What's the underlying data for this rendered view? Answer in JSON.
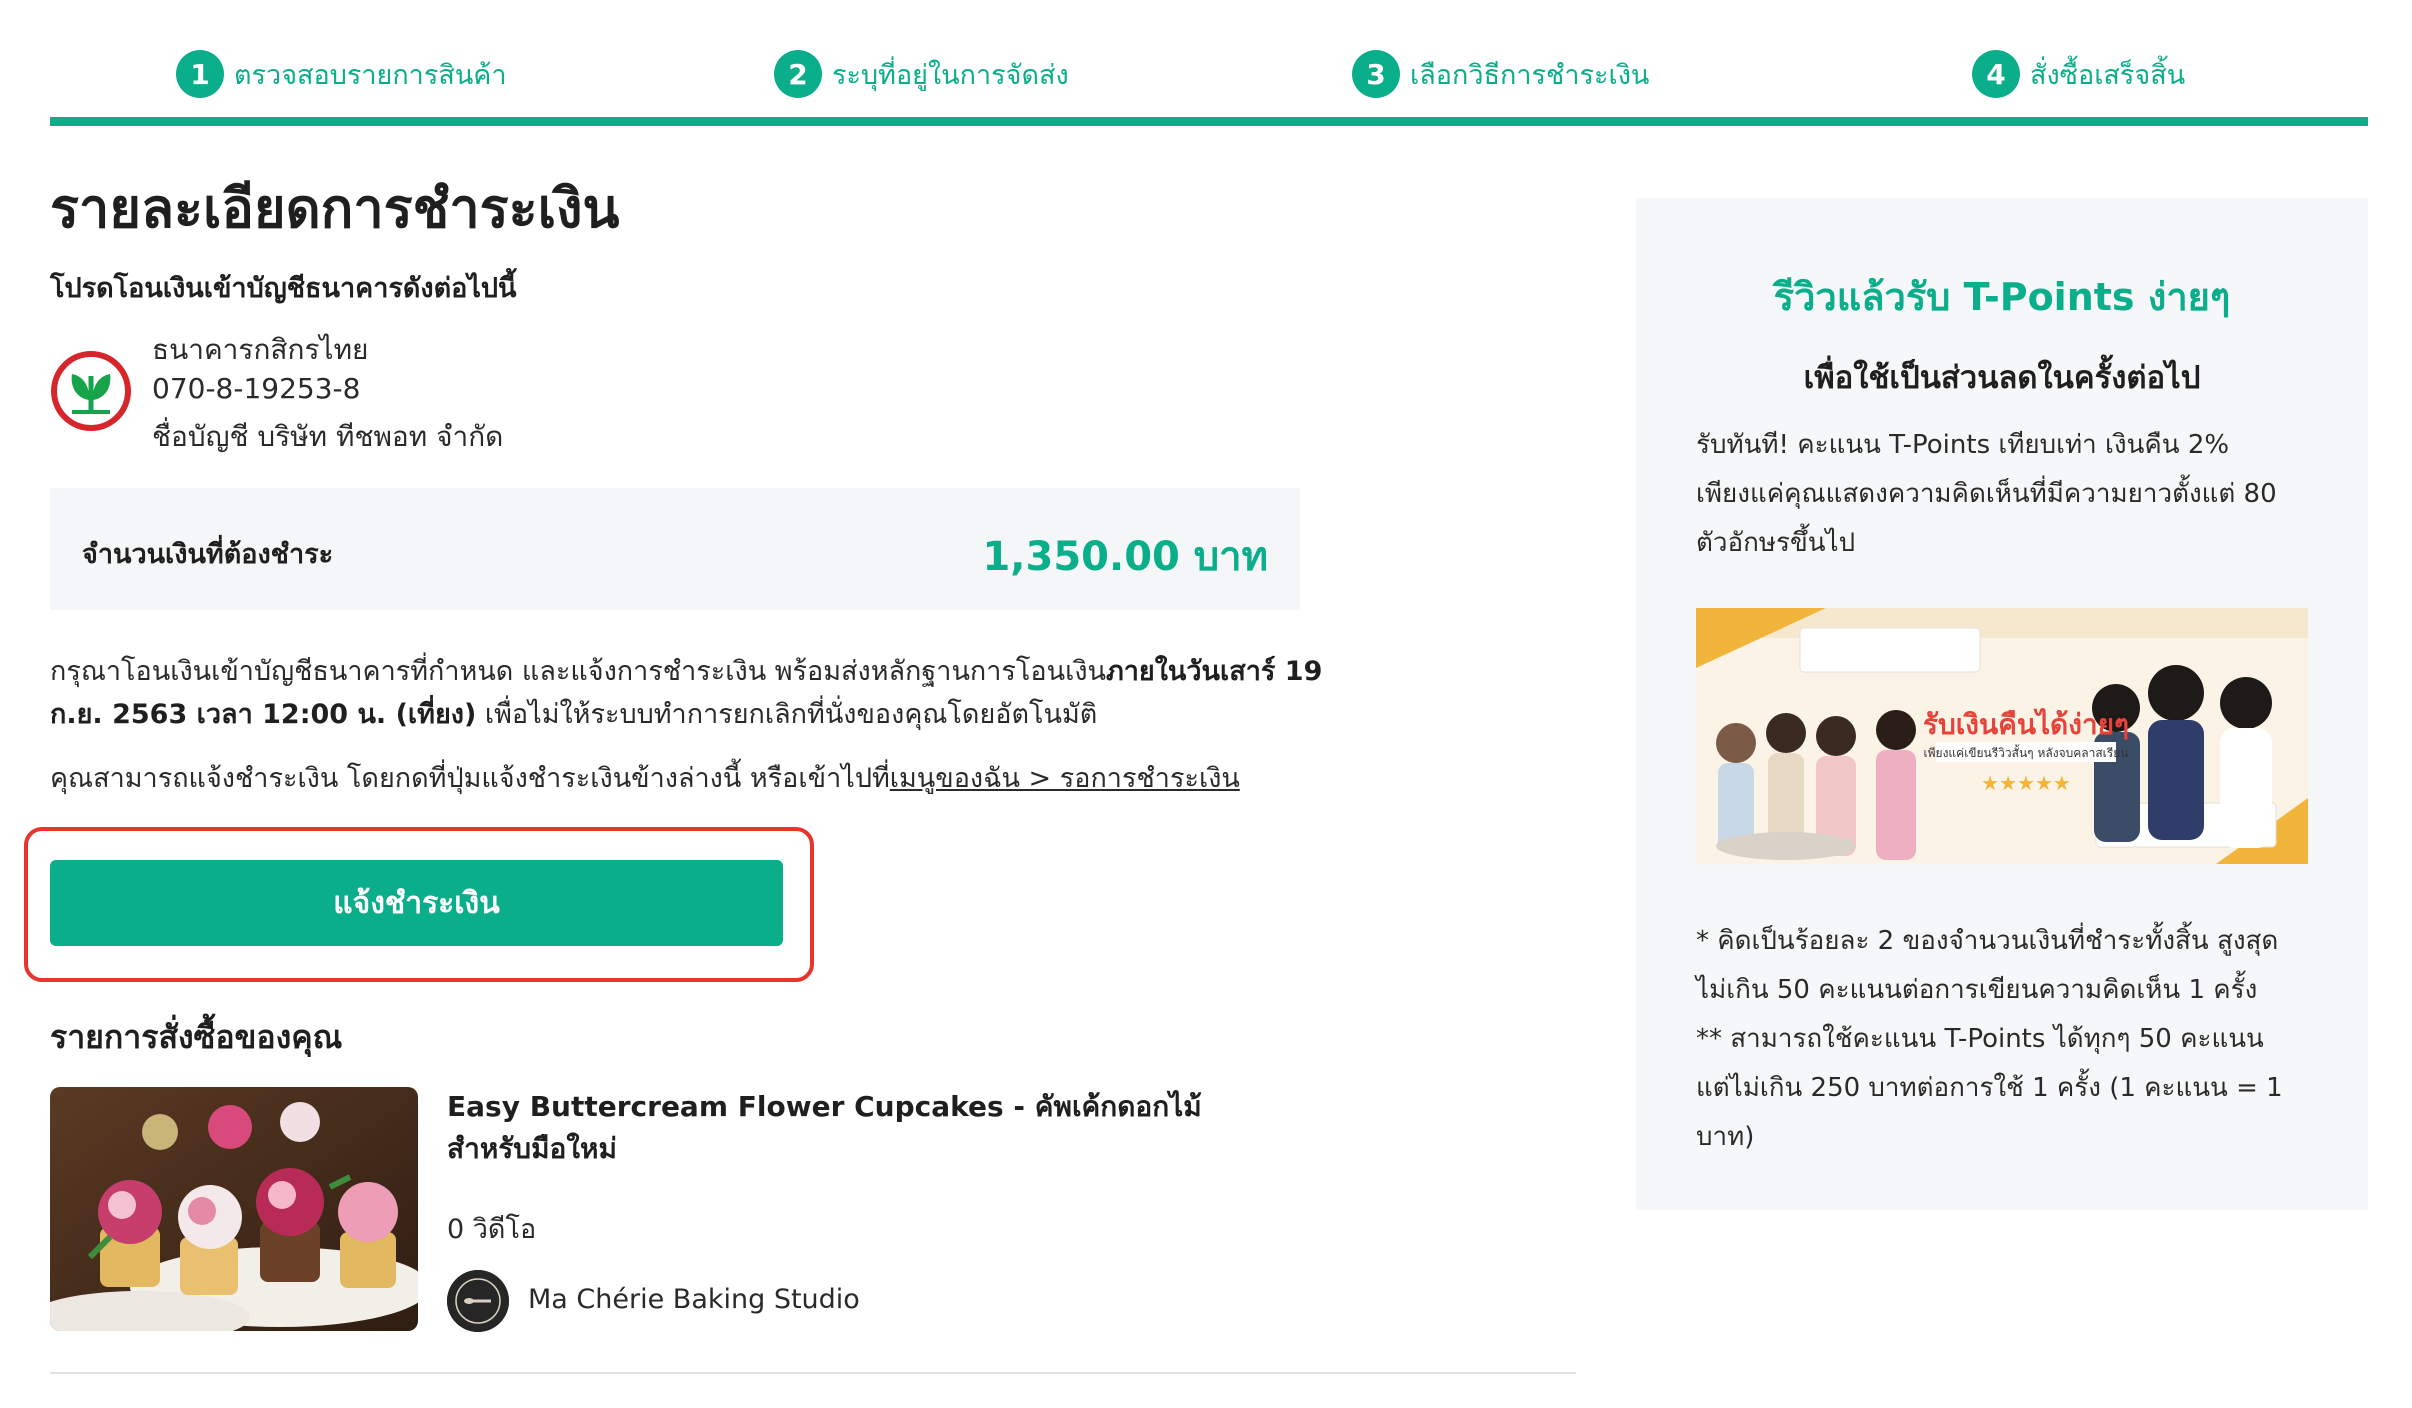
{
  "stepper": {
    "steps": [
      {
        "number": "1",
        "label": "ตรวจสอบรายการสินค้า"
      },
      {
        "number": "2",
        "label": "ระบุที่อยู่ในการจัดส่ง"
      },
      {
        "number": "3",
        "label": "เลือกวิธีการชำระเงิน"
      },
      {
        "number": "4",
        "label": "สั่งซื้อเสร็จสิ้น"
      }
    ]
  },
  "payment": {
    "title": "รายละเอียดการชำระเงิน",
    "instruction": "โปรดโอนเงินเข้าบัญชีธนาคารดังต่อไปนี้",
    "bank": {
      "name": "ธนาคารกสิกรไทย",
      "account_number": "070-8-19253-8",
      "account_name": "ชื่อบัญชี บริษัท ทีชพอท จำกัด"
    },
    "amount_label": "จำนวนเงินที่ต้องชำระ",
    "amount_value": "1,350.00 บาท",
    "notice_line1_prefix": "กรุณาโอนเงินเข้าบัญชีธนาคารที่กำหนด และแจ้งการชำระเงิน พร้อมส่งหลักฐานการโอนเงิน",
    "notice_line1_bold": "ภายในวันเสาร์ 19",
    "notice_line2_bold": "ก.ย. 2563 เวลา 12:00 น. (เที่ยง)",
    "notice_line2_suffix": " เพื่อไม่ให้ระบบทำการยกเลิกที่นั่งของคุณโดยอัตโนมัติ",
    "hint_prefix": "คุณสามารถแจ้งชำระเงิน โดยกดที่ปุ่มแจ้งชำระเงินข้างล่างนี้ หรือเข้าไปที่",
    "hint_link": "เมนูของฉัน > รอการชำระเงิน",
    "pay_button": "แจ้งชำระเงิน"
  },
  "orders": {
    "title": "รายการสั่งซื้อของคุณ",
    "items": [
      {
        "title_line1": "Easy Buttercream Flower Cupcakes - คัพเค้กดอกไม้",
        "title_line2": "สำหรับมือใหม่",
        "videos": "0 วิดีโอ",
        "studio": "Ma Chérie Baking Studio"
      }
    ]
  },
  "side_panel": {
    "heading": "รีวิวแล้วรับ T-Points ง่ายๆ",
    "subheading": "เพื่อใช้เป็นส่วนลดในครั้งต่อไป",
    "body_lines": [
      "รับทันที! คะแนน T-Points เทียบเท่า เงินคืน 2%",
      "เพียงแค่คุณแสดงความคิดเห็นที่มีความยาวตั้งแต่ 80",
      "ตัวอักษรขึ้นไป"
    ],
    "promo": {
      "headline": "รับเงินคืนได้ง่ายๆ",
      "subline": "เพียงแค่เขียนรีวิวสั้นๆ หลังจบคลาสเรียน",
      "stars": "★★★★★"
    },
    "footnotes": [
      "* คิดเป็นร้อยละ 2 ของจำนวนเงินที่ชำระทั้งสิ้น สูงสุด",
      "ไม่เกิน 50 คะแนนต่อการเขียนความคิดเห็น 1 ครั้ง",
      "** สามารถใช้คะแนน T-Points ได้ทุกๆ 50 คะแนน",
      "แต่ไม่เกิน 250 บาทต่อการใช้ 1 ครั้ง (1 คะแนน = 1",
      "บาท)"
    ]
  },
  "colors": {
    "accent": "#0aae8a",
    "highlight_outline": "#e8342c",
    "bank_red": "#d6262b",
    "bank_green": "#16a34a",
    "panel_bg": "#f6f7f8"
  }
}
